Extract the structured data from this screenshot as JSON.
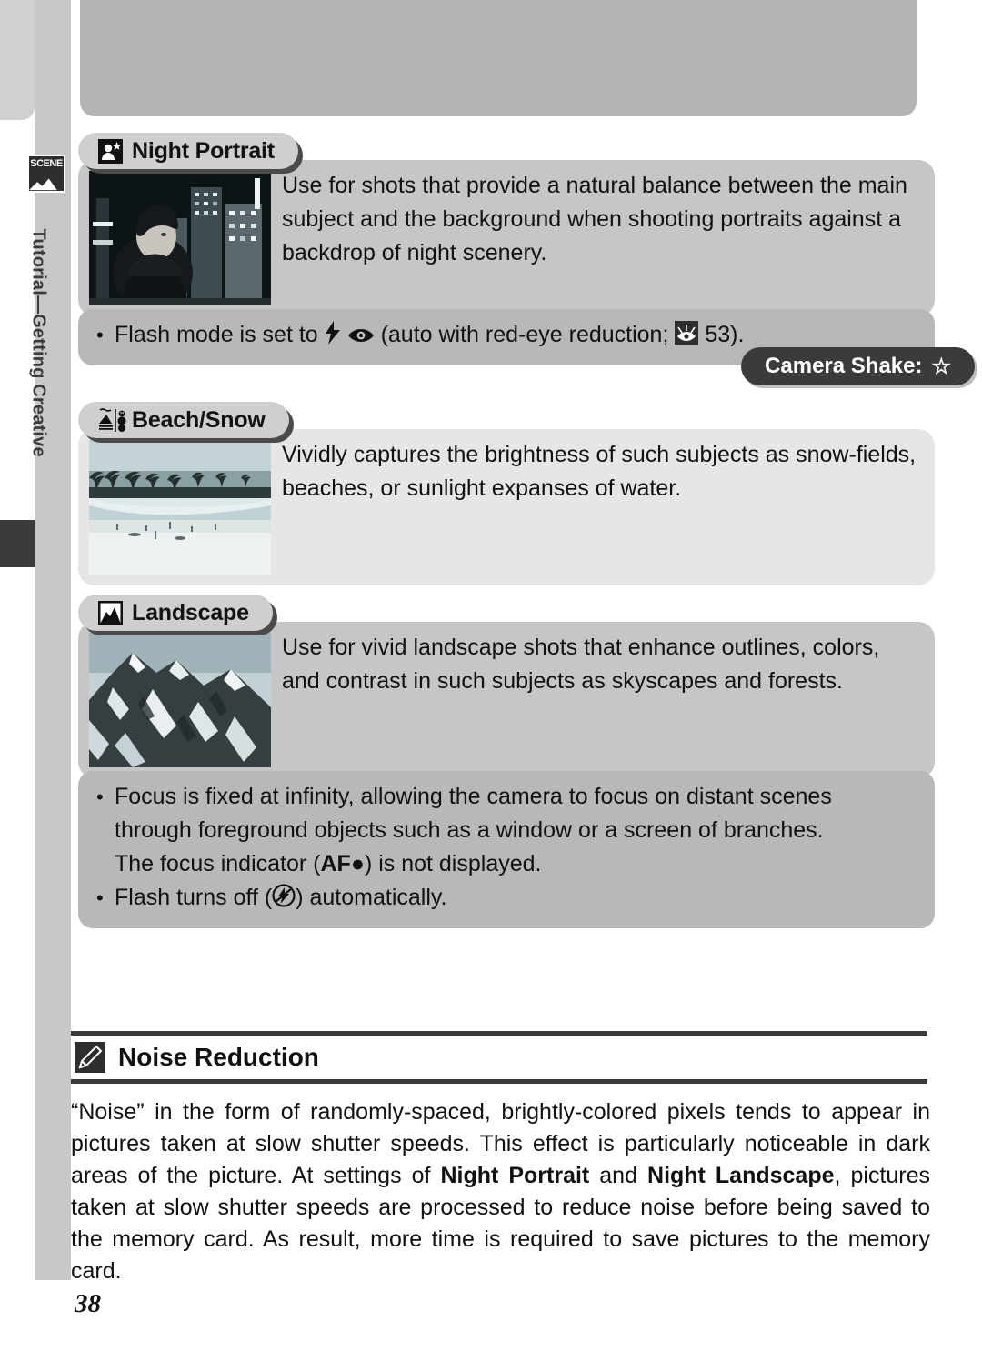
{
  "sidebar": {
    "chapter_label": "Tutorial—Getting Creative",
    "badge_text": "SCENE",
    "badge_icon": "scene-mountain-icon"
  },
  "page": {
    "number": "38"
  },
  "scene_modes": [
    {
      "id": "night-portrait",
      "title": "Night Portrait",
      "icon": "person-with-star-icon",
      "photo_alt": "night-city-portrait-photo",
      "body": "Use for shots that provide a natural balance between the main subject and the background when shooting portraits against a backdrop of night scenery.",
      "notes": [
        {
          "prefix": "Flash mode is set to",
          "icons": [
            "flash-bolt-icon",
            "red-eye-icon"
          ],
          "suffix_before_ref": "(auto with red-eye reduction;",
          "ref_icon": "page-reference-eye-icon",
          "ref_page": "53",
          "suffix_after_ref": ")."
        }
      ],
      "badge": {
        "label": "Camera Shake:",
        "symbol": "☆",
        "name": "camera-shake-badge"
      }
    },
    {
      "id": "beach-snow",
      "title": "Beach/Snow",
      "icon": "beach-snowman-icon",
      "photo_alt": "tropical-beach-photo",
      "body": "Vividly captures the brightness of such subjects as snow-fields, beaches, or sunlight expanses of water.",
      "notes": []
    },
    {
      "id": "landscape",
      "title": "Landscape",
      "icon": "mountain-frame-icon",
      "photo_alt": "snowy-mountain-photo",
      "body": "Use for vivid landscape shots that enhance outlines, colors, and contrast in such subjects as skyscapes and forests.",
      "notes": [
        {
          "line1": "Focus is fixed at infinity, allowing the camera to focus on distant scenes",
          "line2": "through foreground objects such as a window or a screen of branches.",
          "line3_a": "The focus indicator (",
          "line3_af": "AF●",
          "line3_b": ") is not displayed."
        },
        {
          "line1_a": "Flash turns off (",
          "icon": "flash-off-icon",
          "line1_b": ") automatically."
        }
      ]
    }
  ],
  "noise_reduction": {
    "icon": "pencil-note-icon",
    "title": "Noise Reduction",
    "paragraph_part1": "“Noise” in the form of randomly-spaced, brightly-colored pixels tends to appear in pictures taken at slow shutter speeds.  This effect is particularly noticeable in dark areas of the picture.  At settings of ",
    "bold1": "Night Portrait",
    "paragraph_part2": " and ",
    "bold2": "Night Landscape",
    "paragraph_part3": ", pictures taken at slow shutter speeds are processed to reduce noise before being saved to the memory card.  As result, more time is required to save pictures to the memory card."
  },
  "colors": {
    "page_background": "#ffffff",
    "sidebar_tab": "#c8c8c8",
    "header_pill": "#cfcfcf",
    "body_panel": "#c6c6c6",
    "body_panel_light": "#e6e6e6",
    "notes_panel": "#b8b8b8",
    "badge_dark": "#3b3b3b",
    "text": "#111111",
    "rule": "#3a3a3a",
    "top_block": "#b4b4b4"
  }
}
